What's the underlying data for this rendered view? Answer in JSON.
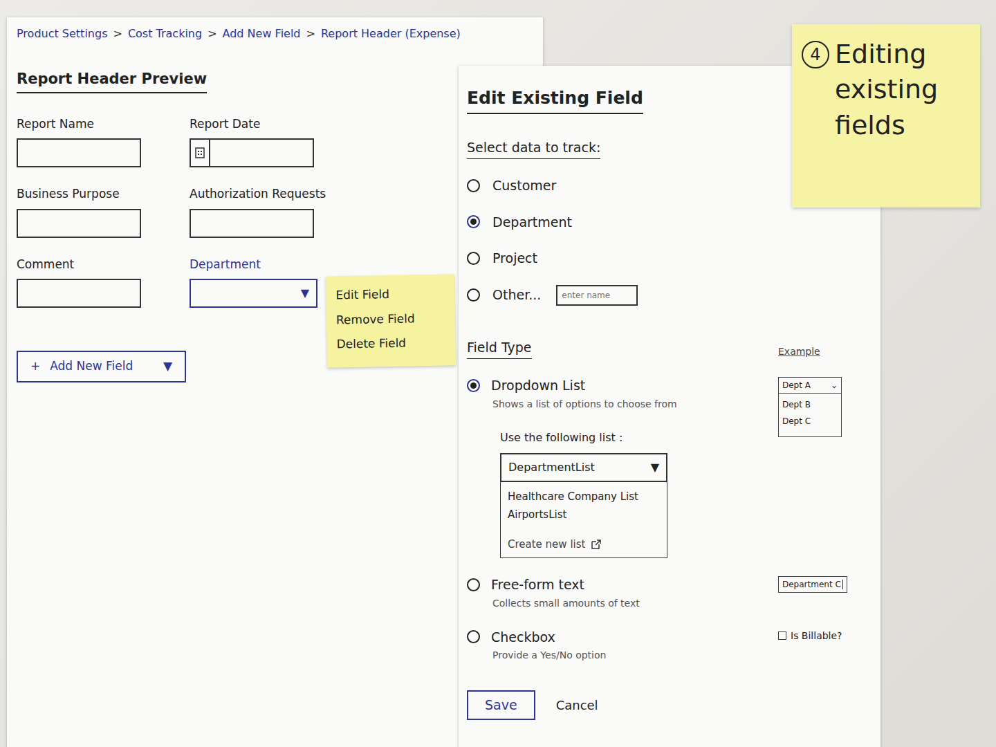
{
  "breadcrumb": {
    "items": [
      "Product Settings",
      "Cost Tracking",
      "Add New Field",
      "Report Header (Expense)"
    ],
    "separator": ">"
  },
  "preview": {
    "title": "Report Header Preview",
    "fields": [
      {
        "label": "Report Name",
        "kind": "text",
        "highlighted": false
      },
      {
        "label": "Report Date",
        "kind": "date",
        "highlighted": false
      },
      {
        "label": "Business Purpose",
        "kind": "text",
        "highlighted": false
      },
      {
        "label": "Authorization Requests",
        "kind": "text",
        "highlighted": false
      },
      {
        "label": "Comment",
        "kind": "text",
        "highlighted": false
      },
      {
        "label": "Department",
        "kind": "dropdown",
        "highlighted": true,
        "arrow": "▼",
        "menu_icon": "⋮"
      }
    ],
    "add_button": {
      "icon": "+",
      "label": "Add New Field",
      "arrow": "▼"
    }
  },
  "field_menu": {
    "items": [
      "Edit Field",
      "Remove Field",
      "Delete Field"
    ]
  },
  "edit_panel": {
    "title": "Edit Existing Field",
    "data_heading": "Select data to track:",
    "data_options": [
      {
        "label": "Customer",
        "selected": false
      },
      {
        "label": "Department",
        "selected": true
      },
      {
        "label": "Project",
        "selected": false
      },
      {
        "label": "Other...",
        "selected": false,
        "placeholder": "enter name"
      }
    ],
    "type_heading": "Field Type",
    "example_heading": "Example",
    "field_types": [
      {
        "name": "Dropdown List",
        "description": "Shows a list of options to choose from",
        "selected": true,
        "kind": "dropdown",
        "list_picker": {
          "label": "Use the following list :",
          "value": "DepartmentList",
          "arrow": "▼",
          "expanded": true,
          "options": [
            "Healthcare Company List",
            "AirportsList"
          ],
          "create_label": "Create new list"
        },
        "example": {
          "value": "Dept A",
          "arrow": "⌄",
          "options": [
            "Dept B",
            "Dept C"
          ]
        }
      },
      {
        "name": "Free-form text",
        "description": "Collects small amounts of text",
        "selected": false,
        "kind": "text",
        "example": {
          "value": "Department C"
        }
      },
      {
        "name": "Checkbox",
        "description": "Provide a Yes/No option",
        "selected": false,
        "kind": "checkbox",
        "example": {
          "label": "Is Billable?",
          "checked": false
        }
      }
    ],
    "save_label": "Save",
    "cancel_label": "Cancel"
  },
  "sticky_note": {
    "number": "4",
    "text": "Editing existing fields"
  }
}
